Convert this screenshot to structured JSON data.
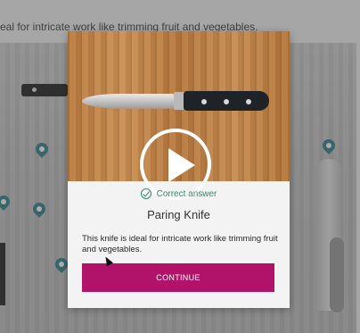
{
  "background": {
    "caption": "eal for intricate work like trimming fruit and vegetables."
  },
  "modal": {
    "feedback": "Correct answer",
    "title": "Paring Knife",
    "description": "This knife is ideal for intricate work like trimming fruit and vegetables.",
    "continue_label": "CONTINUE"
  },
  "colors": {
    "accent": "#b1126a",
    "success": "#2f8f6b"
  }
}
